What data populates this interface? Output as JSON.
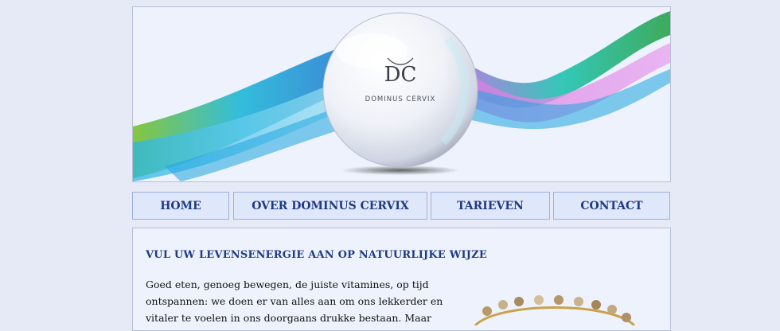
{
  "banner": {
    "logo_monogram": "DC",
    "logo_text": "DOMINUS CERVIX"
  },
  "nav": {
    "items": [
      {
        "label": "HOME"
      },
      {
        "label": "OVER DOMINUS CERVIX"
      },
      {
        "label": "TARIEVEN"
      },
      {
        "label": "CONTACT"
      }
    ]
  },
  "content": {
    "headline": "VUL UW LEVENSENERGIE AAN OP NATUURLIJKE WIJZE",
    "lines": [
      "Goed eten, genoeg bewegen, de juiste vitamines, op tijd",
      "ontspannen: we doen er van alles aan om ons lekkerder en",
      "vitaler te voelen in ons doorgaans drukke bestaan. Maar"
    ]
  },
  "colors": {
    "page_bg": "#e6eaf6",
    "panel_bg": "#eef2fd",
    "nav_bg": "#dfe7fb",
    "accent": "#1f3a82"
  }
}
